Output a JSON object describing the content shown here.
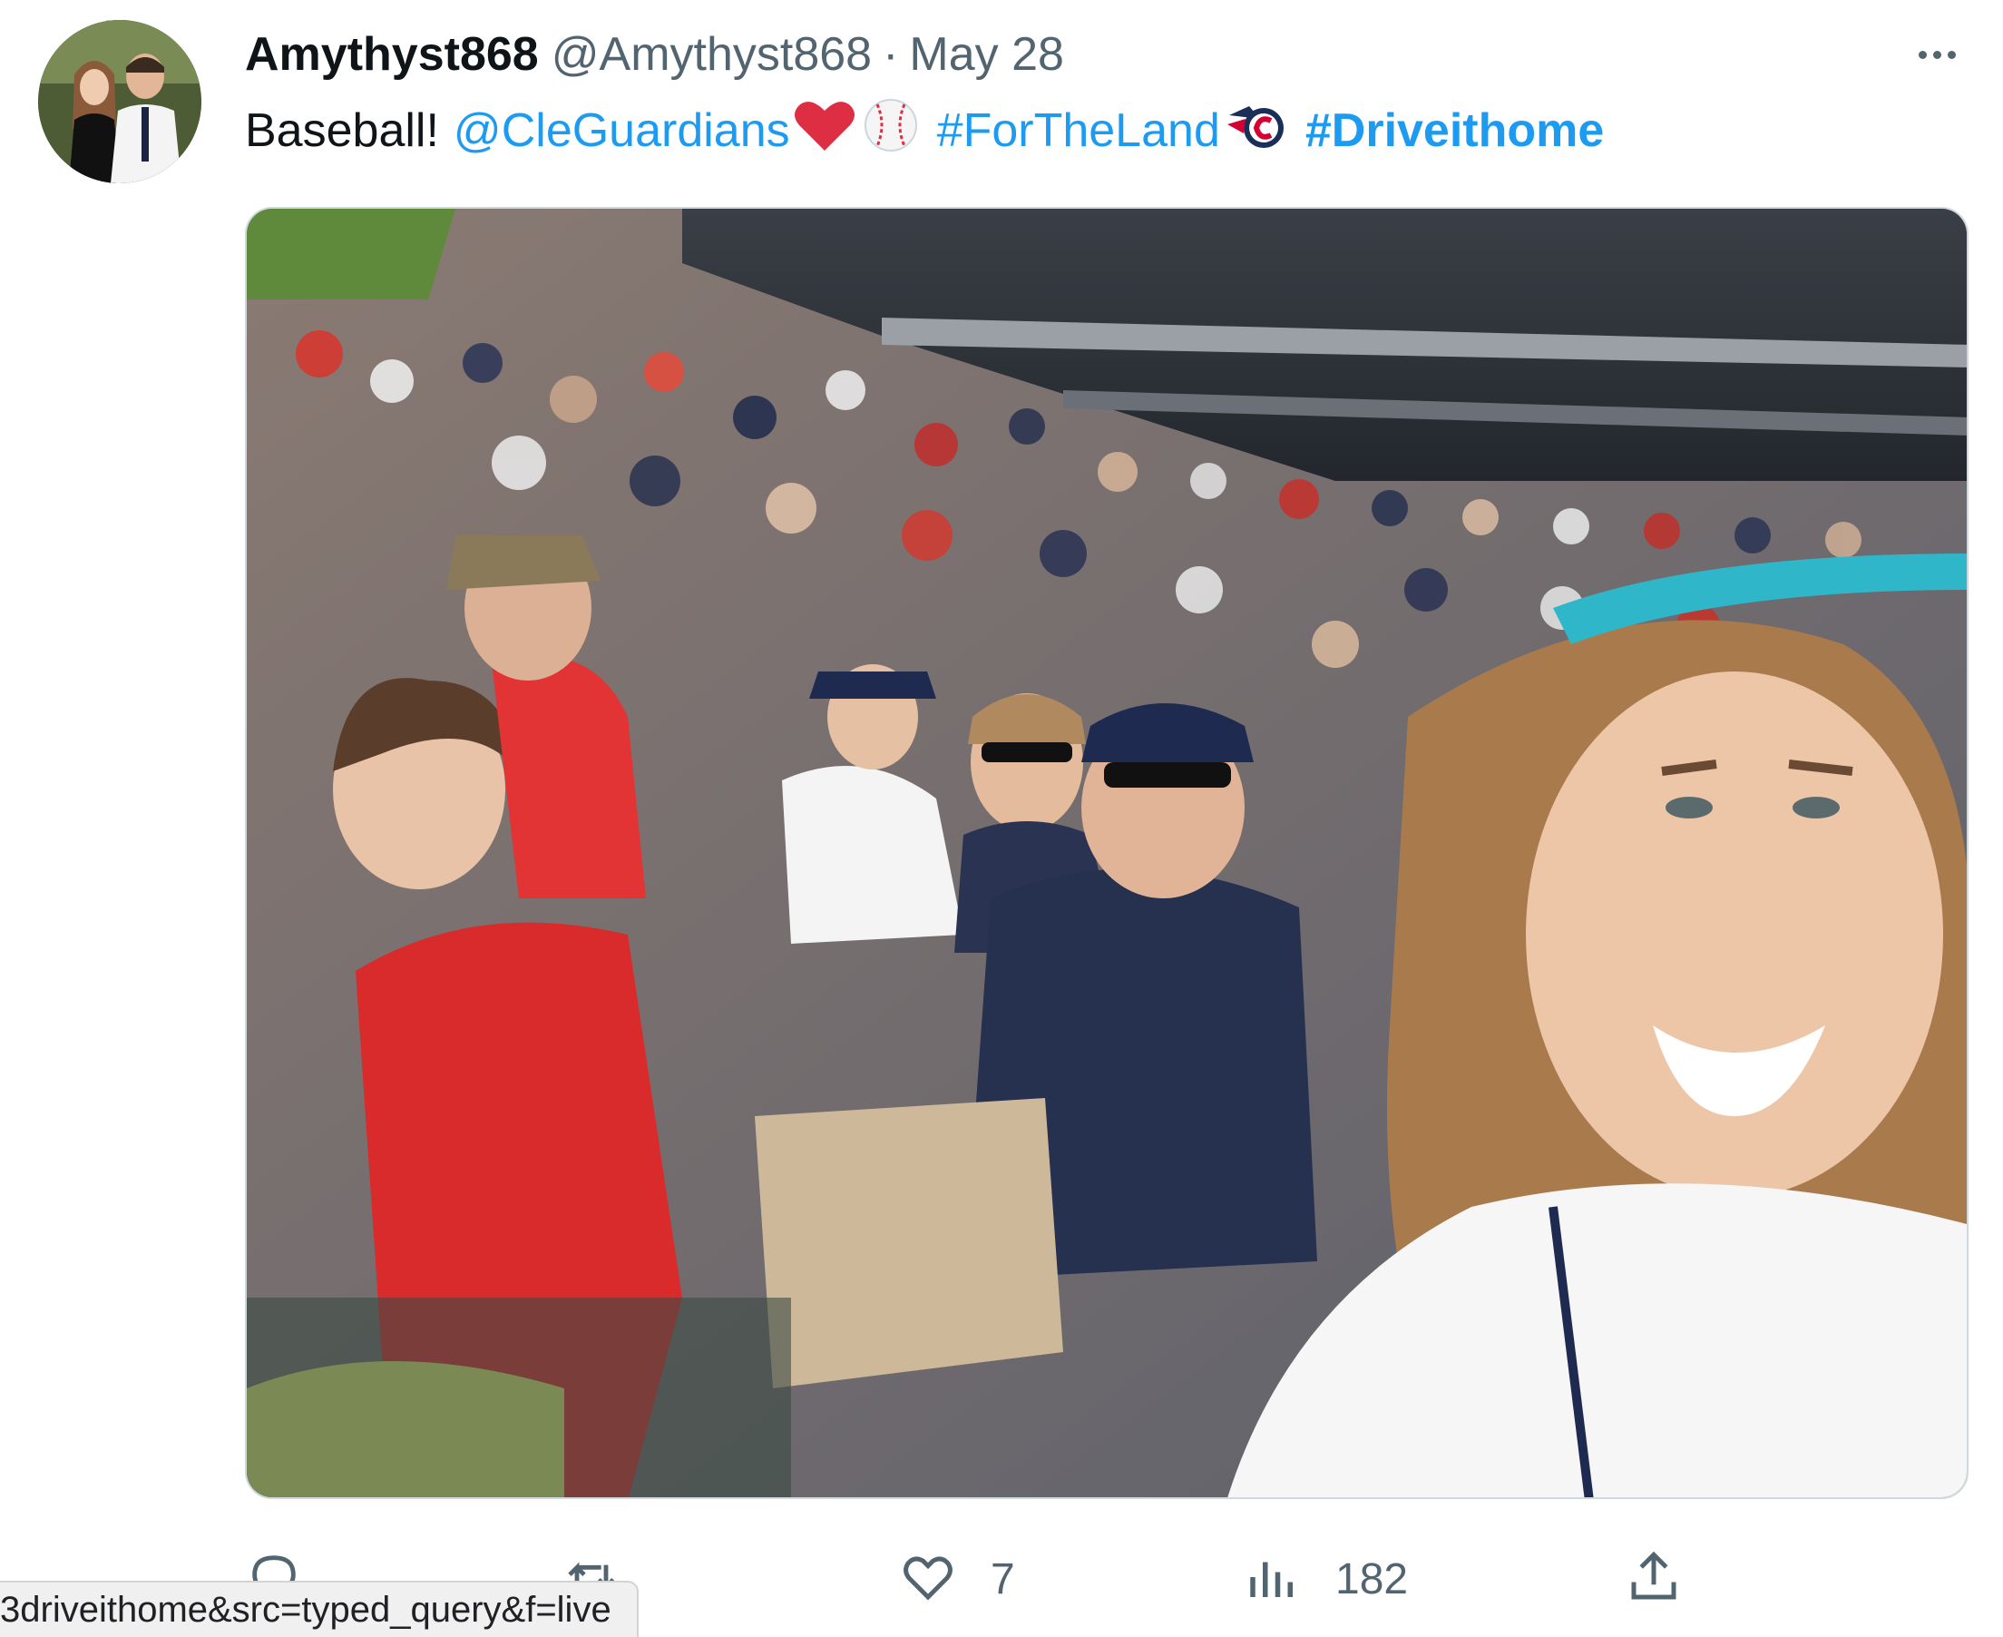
{
  "tweet": {
    "display_name": "Amythyst868",
    "handle": "@Amythyst868",
    "separator": "·",
    "date": "May 28",
    "text": {
      "lead": "Baseball!",
      "mention": "@CleGuardians",
      "hashtag_1": "#ForTheLand",
      "hashtag_2": "#Driveithome"
    },
    "emojis": [
      "red-heart-icon",
      "baseball-icon",
      "guardians-logo-icon"
    ],
    "media_description_icon": "photo"
  },
  "actions": {
    "reply": {
      "icon": "reply-icon",
      "count": ""
    },
    "retweet": {
      "icon": "retweet-icon",
      "count": ""
    },
    "like": {
      "icon": "heart-icon",
      "count": "7"
    },
    "views": {
      "icon": "views-icon",
      "count": "182"
    },
    "share": {
      "icon": "share-icon"
    }
  },
  "status_bar": {
    "url": "3driveithome&src=typed_query&f=live"
  },
  "colors": {
    "text": "#0f1419",
    "secondary": "#536471",
    "link": "#1d9bf0",
    "heart": "#e0245e"
  }
}
